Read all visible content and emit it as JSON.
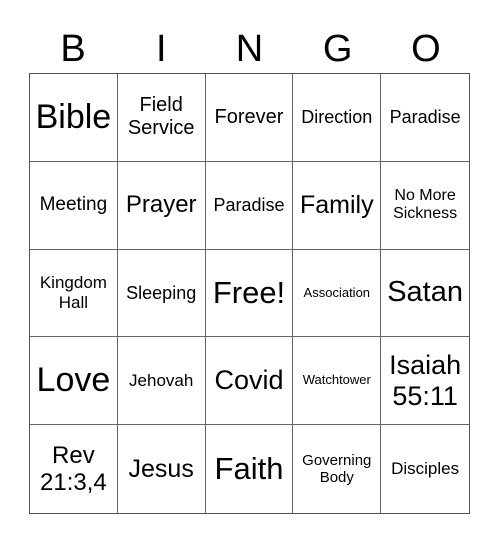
{
  "header": [
    "B",
    "I",
    "N",
    "G",
    "O"
  ],
  "cells": [
    "Bible",
    "Field Service",
    "Forever",
    "Direction",
    "Paradise",
    "Meeting",
    "Prayer",
    "Paradise",
    "Family",
    "No More Sickness",
    "Kingdom Hall",
    "Sleeping",
    "Free!",
    "Association",
    "Satan",
    "Love",
    "Jehovah",
    "Covid",
    "Watchtower",
    "Isaiah 55:11",
    "Rev 21:3,4",
    "Jesus",
    "Faith",
    "Governing Body",
    "Disciples"
  ]
}
